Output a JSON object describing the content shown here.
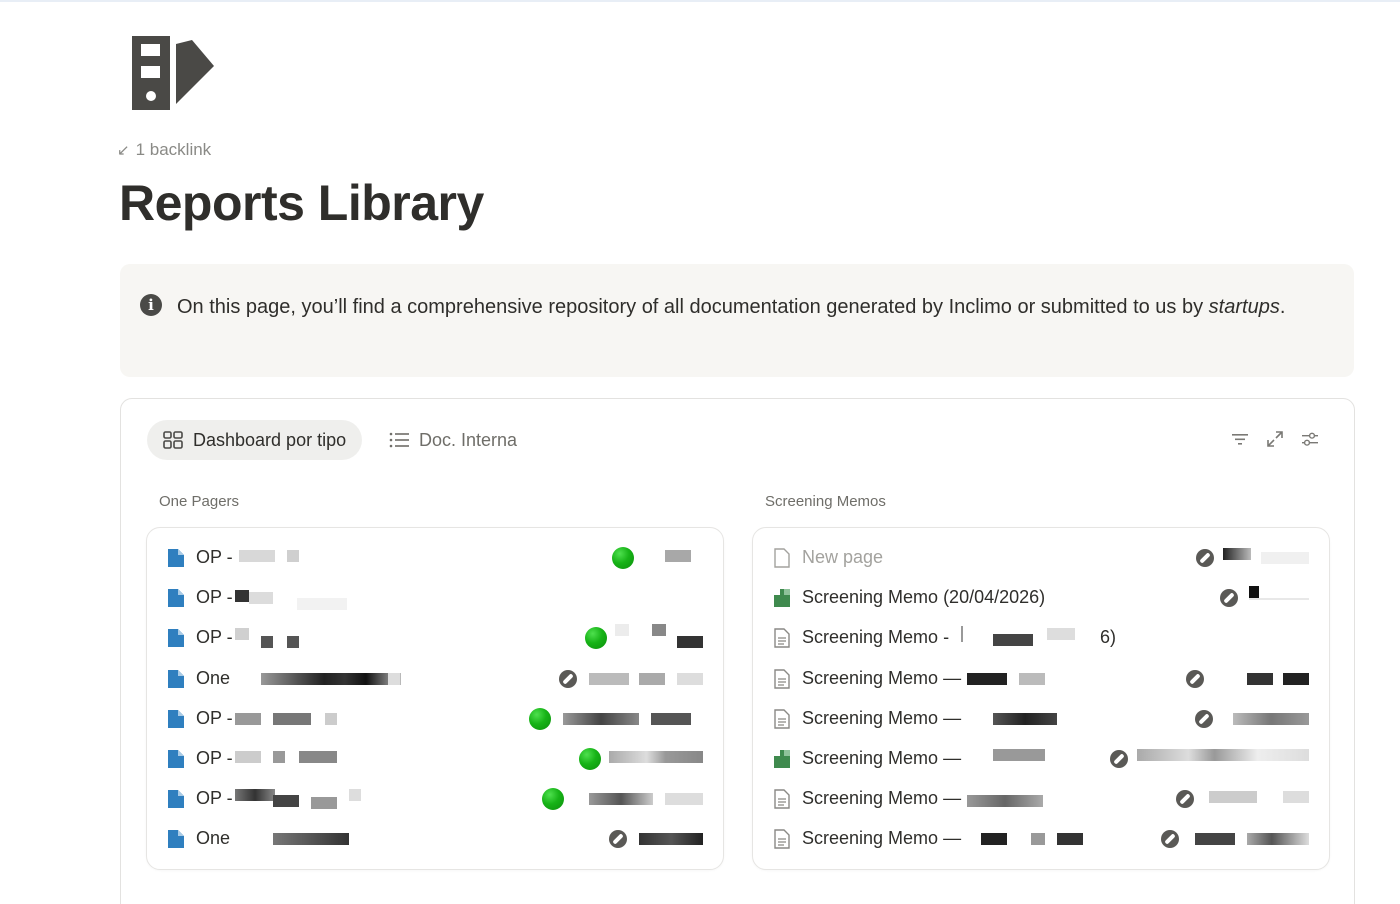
{
  "page": {
    "backlinks": "1 backlink",
    "title": "Reports Library",
    "callout_text": "On this page, you’ll find a comprehensive repository of all documentation generated by Inclimo or submitted to us by ",
    "callout_italic": "startups",
    "callout_end": "."
  },
  "database": {
    "tabs": [
      {
        "label": "Dashboard por tipo",
        "icon": "board-icon",
        "active": true
      },
      {
        "label": "Doc. Interna",
        "icon": "list-icon",
        "active": false
      }
    ],
    "toolbar": [
      "filter-icon",
      "expand-icon",
      "settings-icon"
    ],
    "groups": [
      {
        "label": "One Pagers",
        "items": [
          {
            "name": "OP -",
            "status": "green"
          },
          {
            "name": "OP -",
            "status": "none"
          },
          {
            "name": "OP -",
            "status": "green"
          },
          {
            "name": "One",
            "status": "compass"
          },
          {
            "name": "OP -",
            "status": "green"
          },
          {
            "name": "OP -",
            "status": "green"
          },
          {
            "name": "OP -",
            "status": "green"
          },
          {
            "name": "One",
            "status": "compass"
          }
        ]
      },
      {
        "label": "Screening Memos",
        "items": [
          {
            "name": "New page",
            "icon": "blank",
            "status": "compass"
          },
          {
            "name": "Screening Memo (20/04/2026)",
            "icon": "green-doc",
            "status": "compass"
          },
          {
            "name": "Screening Memo -",
            "icon": "blank",
            "status": "none",
            "suffix": "6)"
          },
          {
            "name": "Screening Memo —",
            "icon": "blank",
            "status": "compass"
          },
          {
            "name": "Screening Memo —",
            "icon": "blank",
            "status": "compass"
          },
          {
            "name": "Screening Memo —",
            "icon": "green-doc",
            "status": "compass"
          },
          {
            "name": "Screening Memo —",
            "icon": "blank",
            "status": "compass"
          },
          {
            "name": "Screening Memo —",
            "icon": "blank",
            "status": "compass"
          }
        ]
      }
    ]
  },
  "colors": {
    "status_green": "#17b317",
    "doc_blue": "#2f7fbf",
    "doc_green": "#3f8a4e"
  }
}
